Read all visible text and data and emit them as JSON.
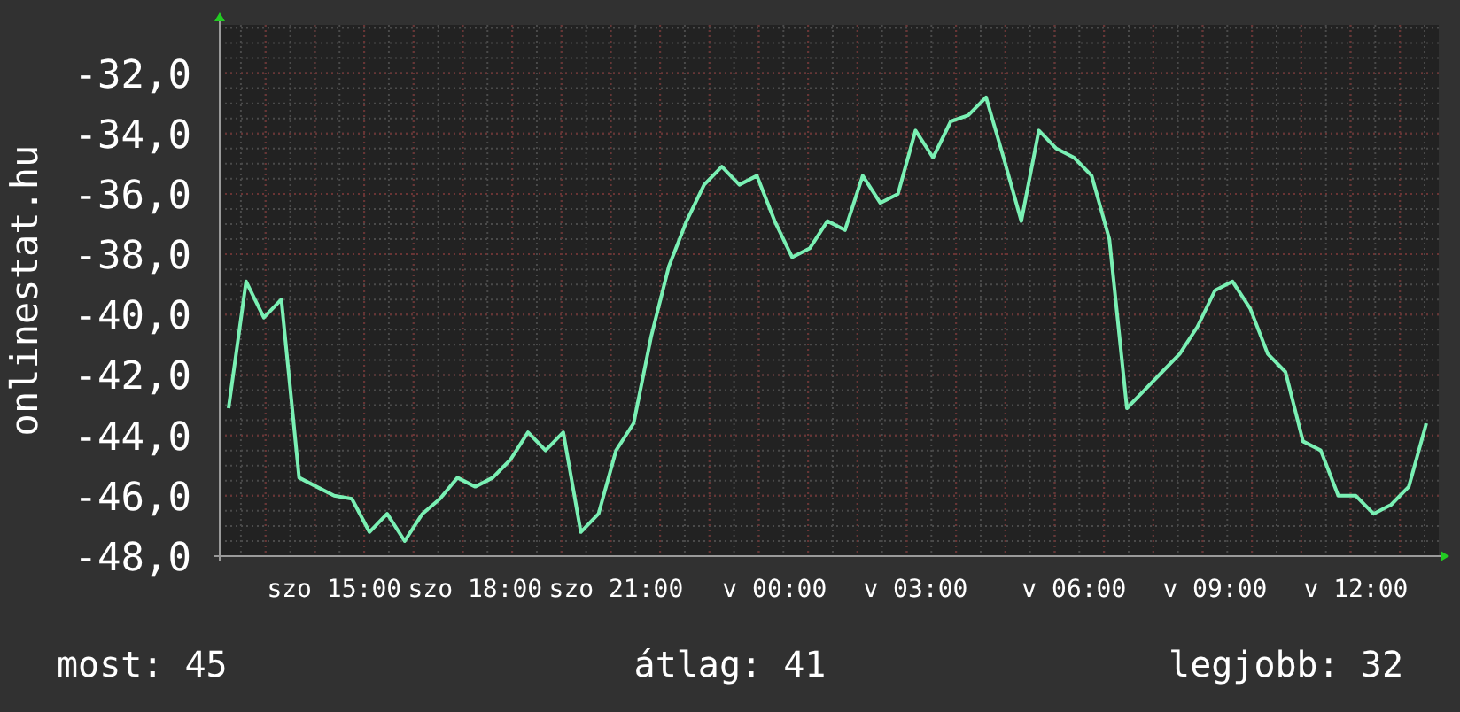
{
  "chart_data": {
    "type": "line",
    "grid": true,
    "ylabel": "onlinestat.hu",
    "ylim": [
      -48,
      -30.4
    ],
    "categories": [
      null,
      null,
      null,
      null,
      null,
      null,
      "szo 15:00",
      null,
      null,
      null,
      null,
      null,
      null,
      null,
      "szo 18:00",
      null,
      null,
      null,
      null,
      null,
      null,
      null,
      "szo 21:00",
      null,
      null,
      null,
      null,
      null,
      null,
      null,
      null,
      "v 00:00",
      null,
      null,
      null,
      null,
      null,
      null,
      null,
      "v 03:00",
      null,
      null,
      null,
      null,
      null,
      null,
      null,
      null,
      "v 06:00",
      null,
      null,
      null,
      null,
      null,
      null,
      null,
      "v 09:00",
      null,
      null,
      null,
      null,
      null,
      null,
      null,
      "v 12:00",
      null,
      null,
      null,
      null
    ],
    "yticks": [
      {
        "value": -32,
        "label": "-32,0"
      },
      {
        "value": -34,
        "label": "-34,0"
      },
      {
        "value": -36,
        "label": "-36,0"
      },
      {
        "value": -38,
        "label": "-38,0"
      },
      {
        "value": -40,
        "label": "-40,0"
      },
      {
        "value": -42,
        "label": "-42,0"
      },
      {
        "value": -44,
        "label": "-44,0"
      },
      {
        "value": -46,
        "label": "-46,0"
      },
      {
        "value": -48,
        "label": "-48,0"
      }
    ],
    "series": [
      {
        "color": "#7af0b4",
        "values": [
          -43.1,
          -38.9,
          -40.1,
          -39.5,
          -45.4,
          -45.7,
          -46.0,
          -46.1,
          -47.2,
          -46.6,
          -47.5,
          -46.6,
          -46.1,
          -45.4,
          -45.7,
          -45.4,
          -44.8,
          -43.9,
          -44.5,
          -43.9,
          -47.2,
          -46.6,
          -44.5,
          -43.6,
          -40.7,
          -38.4,
          -36.9,
          -35.7,
          -35.1,
          -35.7,
          -35.4,
          -36.9,
          -38.1,
          -37.8,
          -36.9,
          -37.2,
          -35.4,
          -36.3,
          -36.0,
          -33.9,
          -34.8,
          -33.6,
          -33.4,
          -32.8,
          -34.8,
          -36.9,
          -33.9,
          -34.5,
          -34.8,
          -35.4,
          -37.5,
          -43.1,
          -42.5,
          -41.9,
          -41.3,
          -40.4,
          -39.2,
          -38.9,
          -39.8,
          -41.3,
          -41.9,
          -44.2,
          -44.5,
          -46.0,
          -46.0,
          -46.6,
          -46.3,
          -45.7,
          -43.6
        ]
      }
    ]
  },
  "footer": [
    {
      "text": "most: 45"
    },
    {
      "text": "átlag: 41"
    },
    {
      "text": "legjobb: 32"
    }
  ]
}
